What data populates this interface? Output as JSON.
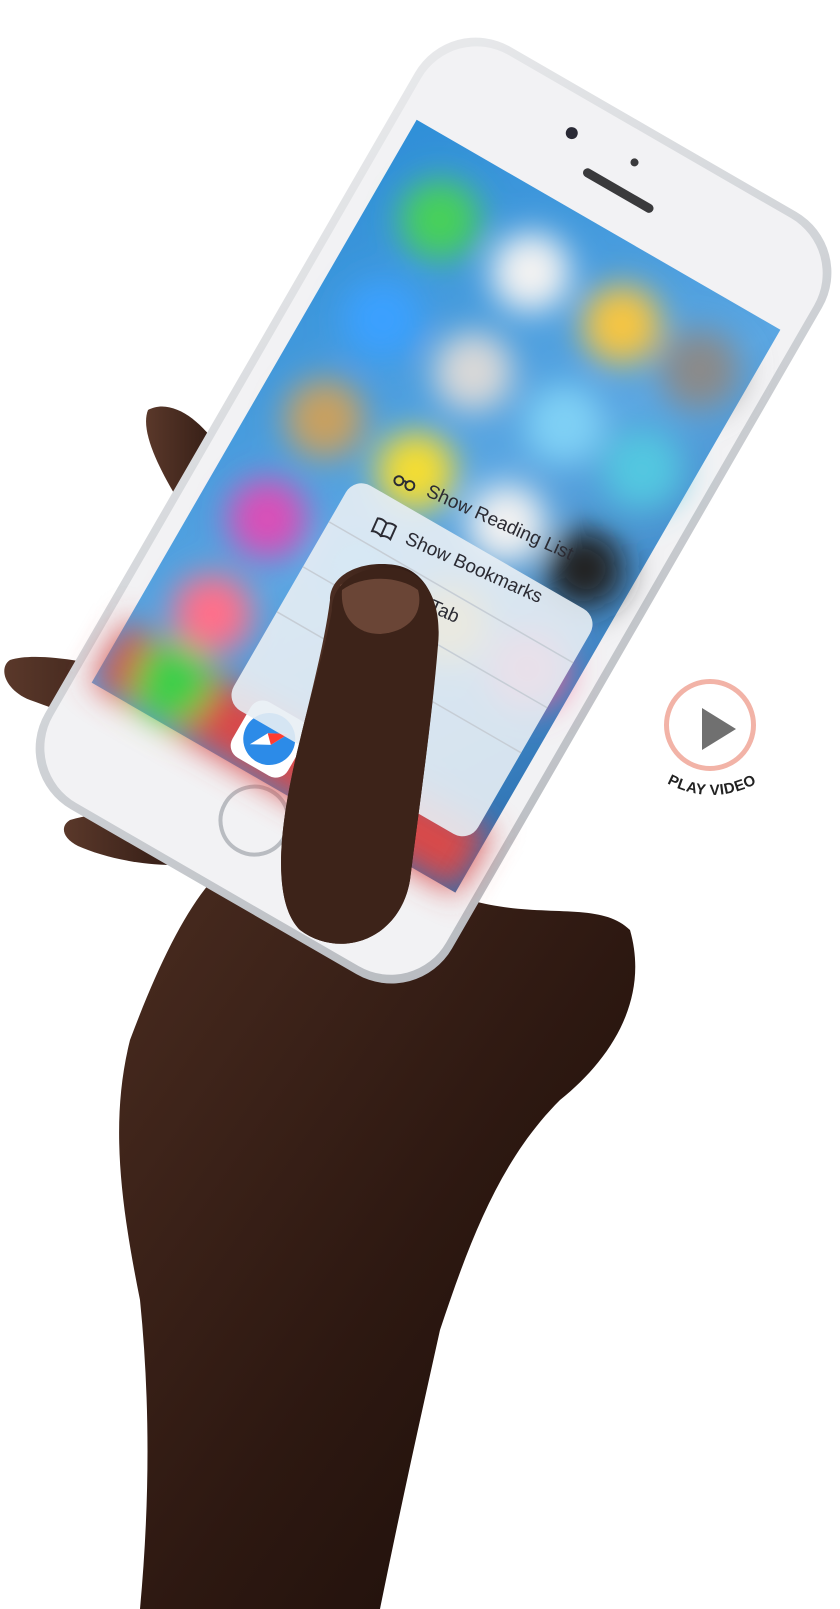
{
  "quick_actions": {
    "items": [
      {
        "label": "Show Reading List",
        "icon": "glasses-icon"
      },
      {
        "label": "Show Bookmarks",
        "icon": "book-icon"
      },
      {
        "label": "rivate Tab",
        "icon": "tab-icon"
      }
    ]
  },
  "play_video": {
    "label": "PLAY VIDEO",
    "icon": "play-icon",
    "ring_color": "#f2b3a7",
    "icon_color": "#707070"
  },
  "phone": {
    "body_color": "#f2f2f4",
    "frame_color": "#cfd2d6"
  }
}
